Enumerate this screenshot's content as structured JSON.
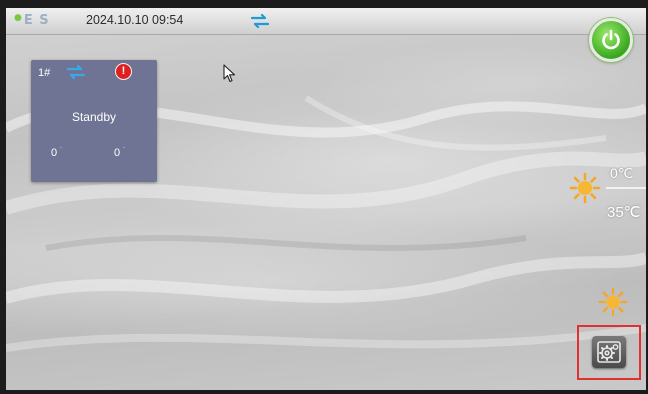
{
  "header": {
    "logo": "E S",
    "datetime": "2024.10.10 09:54",
    "connection_icon": "link-arrows-icon",
    "power_icon": "power-icon"
  },
  "unit_card": {
    "id": "1#",
    "status": "Standby",
    "value_left": "0",
    "value_right": "0",
    "connection_icon": "link-arrows-icon",
    "alarm_icon": "alarm-icon",
    "alarm_symbol": "!"
  },
  "weather": {
    "temp_high": "0℃",
    "temp_low": "35℃",
    "sun_icon": "sun-icon"
  },
  "settings": {
    "icon": "gear-icon"
  },
  "colors": {
    "card": "#6f7494",
    "power": "#38a81e",
    "alarm": "#e02020",
    "link_icon": "#1e9bd7",
    "highlight": "#e03030",
    "sun": "#f5a623"
  }
}
